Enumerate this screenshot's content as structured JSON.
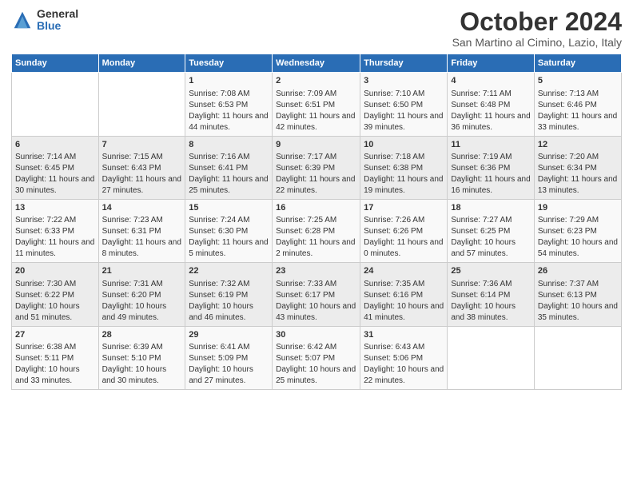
{
  "header": {
    "logo_general": "General",
    "logo_blue": "Blue",
    "month_title": "October 2024",
    "location": "San Martino al Cimino, Lazio, Italy"
  },
  "days_of_week": [
    "Sunday",
    "Monday",
    "Tuesday",
    "Wednesday",
    "Thursday",
    "Friday",
    "Saturday"
  ],
  "weeks": [
    [
      {
        "day": "",
        "content": ""
      },
      {
        "day": "",
        "content": ""
      },
      {
        "day": "1",
        "content": "Sunrise: 7:08 AM\nSunset: 6:53 PM\nDaylight: 11 hours and 44 minutes."
      },
      {
        "day": "2",
        "content": "Sunrise: 7:09 AM\nSunset: 6:51 PM\nDaylight: 11 hours and 42 minutes."
      },
      {
        "day": "3",
        "content": "Sunrise: 7:10 AM\nSunset: 6:50 PM\nDaylight: 11 hours and 39 minutes."
      },
      {
        "day": "4",
        "content": "Sunrise: 7:11 AM\nSunset: 6:48 PM\nDaylight: 11 hours and 36 minutes."
      },
      {
        "day": "5",
        "content": "Sunrise: 7:13 AM\nSunset: 6:46 PM\nDaylight: 11 hours and 33 minutes."
      }
    ],
    [
      {
        "day": "6",
        "content": "Sunrise: 7:14 AM\nSunset: 6:45 PM\nDaylight: 11 hours and 30 minutes."
      },
      {
        "day": "7",
        "content": "Sunrise: 7:15 AM\nSunset: 6:43 PM\nDaylight: 11 hours and 27 minutes."
      },
      {
        "day": "8",
        "content": "Sunrise: 7:16 AM\nSunset: 6:41 PM\nDaylight: 11 hours and 25 minutes."
      },
      {
        "day": "9",
        "content": "Sunrise: 7:17 AM\nSunset: 6:39 PM\nDaylight: 11 hours and 22 minutes."
      },
      {
        "day": "10",
        "content": "Sunrise: 7:18 AM\nSunset: 6:38 PM\nDaylight: 11 hours and 19 minutes."
      },
      {
        "day": "11",
        "content": "Sunrise: 7:19 AM\nSunset: 6:36 PM\nDaylight: 11 hours and 16 minutes."
      },
      {
        "day": "12",
        "content": "Sunrise: 7:20 AM\nSunset: 6:34 PM\nDaylight: 11 hours and 13 minutes."
      }
    ],
    [
      {
        "day": "13",
        "content": "Sunrise: 7:22 AM\nSunset: 6:33 PM\nDaylight: 11 hours and 11 minutes."
      },
      {
        "day": "14",
        "content": "Sunrise: 7:23 AM\nSunset: 6:31 PM\nDaylight: 11 hours and 8 minutes."
      },
      {
        "day": "15",
        "content": "Sunrise: 7:24 AM\nSunset: 6:30 PM\nDaylight: 11 hours and 5 minutes."
      },
      {
        "day": "16",
        "content": "Sunrise: 7:25 AM\nSunset: 6:28 PM\nDaylight: 11 hours and 2 minutes."
      },
      {
        "day": "17",
        "content": "Sunrise: 7:26 AM\nSunset: 6:26 PM\nDaylight: 11 hours and 0 minutes."
      },
      {
        "day": "18",
        "content": "Sunrise: 7:27 AM\nSunset: 6:25 PM\nDaylight: 10 hours and 57 minutes."
      },
      {
        "day": "19",
        "content": "Sunrise: 7:29 AM\nSunset: 6:23 PM\nDaylight: 10 hours and 54 minutes."
      }
    ],
    [
      {
        "day": "20",
        "content": "Sunrise: 7:30 AM\nSunset: 6:22 PM\nDaylight: 10 hours and 51 minutes."
      },
      {
        "day": "21",
        "content": "Sunrise: 7:31 AM\nSunset: 6:20 PM\nDaylight: 10 hours and 49 minutes."
      },
      {
        "day": "22",
        "content": "Sunrise: 7:32 AM\nSunset: 6:19 PM\nDaylight: 10 hours and 46 minutes."
      },
      {
        "day": "23",
        "content": "Sunrise: 7:33 AM\nSunset: 6:17 PM\nDaylight: 10 hours and 43 minutes."
      },
      {
        "day": "24",
        "content": "Sunrise: 7:35 AM\nSunset: 6:16 PM\nDaylight: 10 hours and 41 minutes."
      },
      {
        "day": "25",
        "content": "Sunrise: 7:36 AM\nSunset: 6:14 PM\nDaylight: 10 hours and 38 minutes."
      },
      {
        "day": "26",
        "content": "Sunrise: 7:37 AM\nSunset: 6:13 PM\nDaylight: 10 hours and 35 minutes."
      }
    ],
    [
      {
        "day": "27",
        "content": "Sunrise: 6:38 AM\nSunset: 5:11 PM\nDaylight: 10 hours and 33 minutes."
      },
      {
        "day": "28",
        "content": "Sunrise: 6:39 AM\nSunset: 5:10 PM\nDaylight: 10 hours and 30 minutes."
      },
      {
        "day": "29",
        "content": "Sunrise: 6:41 AM\nSunset: 5:09 PM\nDaylight: 10 hours and 27 minutes."
      },
      {
        "day": "30",
        "content": "Sunrise: 6:42 AM\nSunset: 5:07 PM\nDaylight: 10 hours and 25 minutes."
      },
      {
        "day": "31",
        "content": "Sunrise: 6:43 AM\nSunset: 5:06 PM\nDaylight: 10 hours and 22 minutes."
      },
      {
        "day": "",
        "content": ""
      },
      {
        "day": "",
        "content": ""
      }
    ]
  ]
}
